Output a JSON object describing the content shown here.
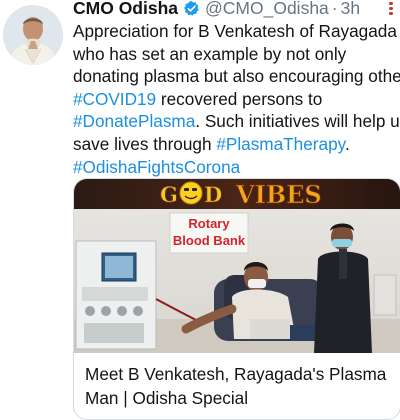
{
  "author": {
    "name": "CMO Odisha",
    "handle": "@CMO_Odisha",
    "separator": "·",
    "time": "3h",
    "avatar_icon": "profile-photo",
    "verified_icon": "verified-badge-icon",
    "verified_color": "#1d9bf0"
  },
  "tweet": {
    "lines": [
      [
        {
          "text": "Appreciation for B Venkatesh of Rayagada",
          "hashtag": false
        }
      ],
      [
        {
          "text": "who has set an example by not only",
          "hashtag": false
        }
      ],
      [
        {
          "text": "donating plasma but also encouraging other",
          "hashtag": false
        }
      ],
      [
        {
          "text": "#COVID19",
          "hashtag": true
        },
        {
          "text": " recovered persons to",
          "hashtag": false
        }
      ],
      [
        {
          "text": "#DonatePlasma",
          "hashtag": true
        },
        {
          "text": ". Such initiatives will help us",
          "hashtag": false
        }
      ],
      [
        {
          "text": "save lives through ",
          "hashtag": false
        },
        {
          "text": "#PlasmaTherapy",
          "hashtag": true
        },
        {
          "text": ".",
          "hashtag": false
        }
      ],
      [
        {
          "text": "#OdishaFightsCorona",
          "hashtag": true
        }
      ]
    ],
    "hashtag_color": "#1d8fe0"
  },
  "card": {
    "banner_g": "G",
    "banner_d": "D",
    "banner_vibes": "VIBES",
    "sign_line1": "Rotary",
    "sign_line2": "Blood Bank",
    "title_line1": "Meet B Venkatesh, Rayagada's Plasma",
    "title_line2": "Man | Odisha Special"
  },
  "more_icon": "more-options-icon"
}
